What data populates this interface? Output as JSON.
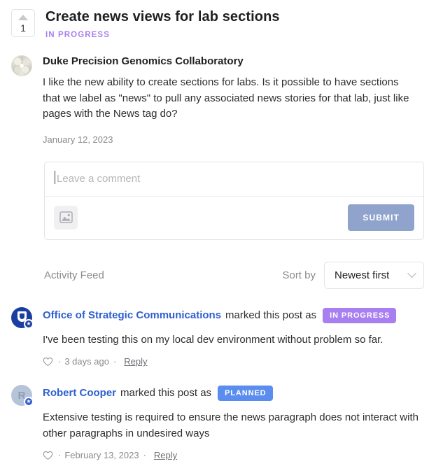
{
  "post": {
    "vote_count": "1",
    "title": "Create news views for lab sections",
    "status": "IN PROGRESS",
    "status_color": "#a87ff0",
    "author": "Duke Precision Genomics Collaboratory",
    "body": "I like the new ability to create sections for labs. Is it possible to have sections that we label as \"news\" to pull any associated news stories for that lab, just like pages with the News tag do?",
    "date": "January 12, 2023"
  },
  "composer": {
    "placeholder": "Leave a comment",
    "value": "",
    "image_icon": "image-icon",
    "submit_label": "SUBMIT",
    "submit_color": "#8fa3cc"
  },
  "feed": {
    "title": "Activity Feed",
    "sort_label": "Sort by",
    "sort_value": "Newest first",
    "sort_options": [
      "Newest first"
    ],
    "chevron_icon": "chevron-down-icon"
  },
  "activities": [
    {
      "avatar_initial": "",
      "avatar_type": "logo",
      "avatar_color": "#1b3fa0",
      "badge_icon": "star-badge-icon",
      "user": "Office of Strategic Communications",
      "action": "marked this post as",
      "status": "IN PROGRESS",
      "status_color": "#a87ff0",
      "text": "I've been testing this on my local dev environment without problem so far.",
      "like_icon": "heart-icon",
      "separator": "·",
      "time": "3 days ago",
      "reply_label": "Reply"
    },
    {
      "avatar_initial": "R",
      "avatar_type": "initial",
      "avatar_color": "#b6c4da",
      "badge_icon": "star-badge-icon",
      "user": "Robert Cooper",
      "action": "marked this post as",
      "status": "PLANNED",
      "status_color": "#5b8def",
      "text": "Extensive testing is required to ensure the news paragraph does not interact with other paragraphs in undesired ways",
      "like_icon": "heart-icon",
      "separator": "·",
      "time": "February 13, 2023",
      "reply_label": "Reply"
    }
  ]
}
